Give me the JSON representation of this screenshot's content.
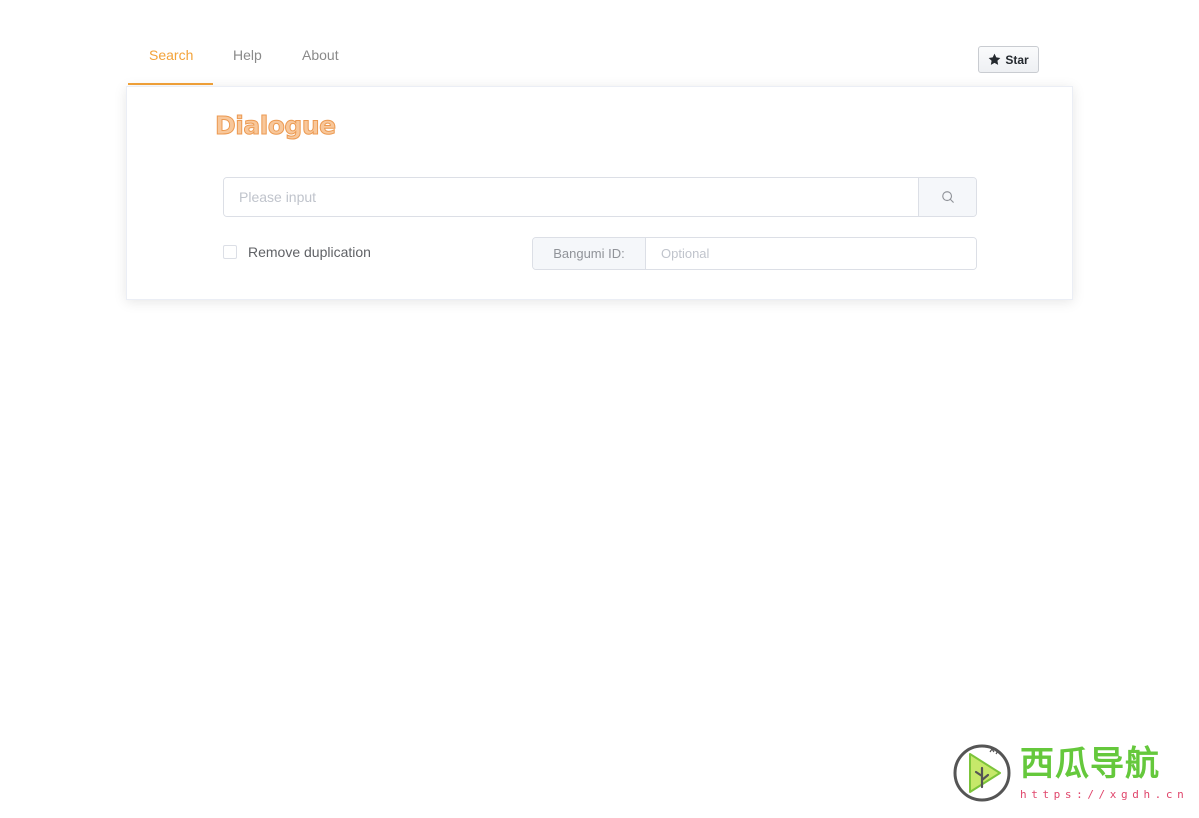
{
  "tabs": [
    {
      "label": "Search",
      "active": true
    },
    {
      "label": "Help",
      "active": false
    },
    {
      "label": "About",
      "active": false
    }
  ],
  "star_button": {
    "label": "Star",
    "icon": "star-icon"
  },
  "card": {
    "logo": "Dialogue",
    "search": {
      "placeholder": "Please input",
      "value": "",
      "button_icon": "search-icon"
    },
    "dedupe": {
      "label": "Remove duplication",
      "checked": false
    },
    "bangumi": {
      "prefix": "Bangumi ID:",
      "placeholder": "Optional",
      "value": ""
    }
  },
  "watermark": {
    "title": "西瓜导航",
    "url": "https://xgdh.cn",
    "icon": "watermelon-play-icon"
  },
  "colors": {
    "accent": "#f3a33a",
    "logo_fill": "#f8c79a",
    "logo_stroke": "#ec9a52",
    "watermark_green": "#65c83c",
    "watermark_pink": "#e0466c"
  }
}
